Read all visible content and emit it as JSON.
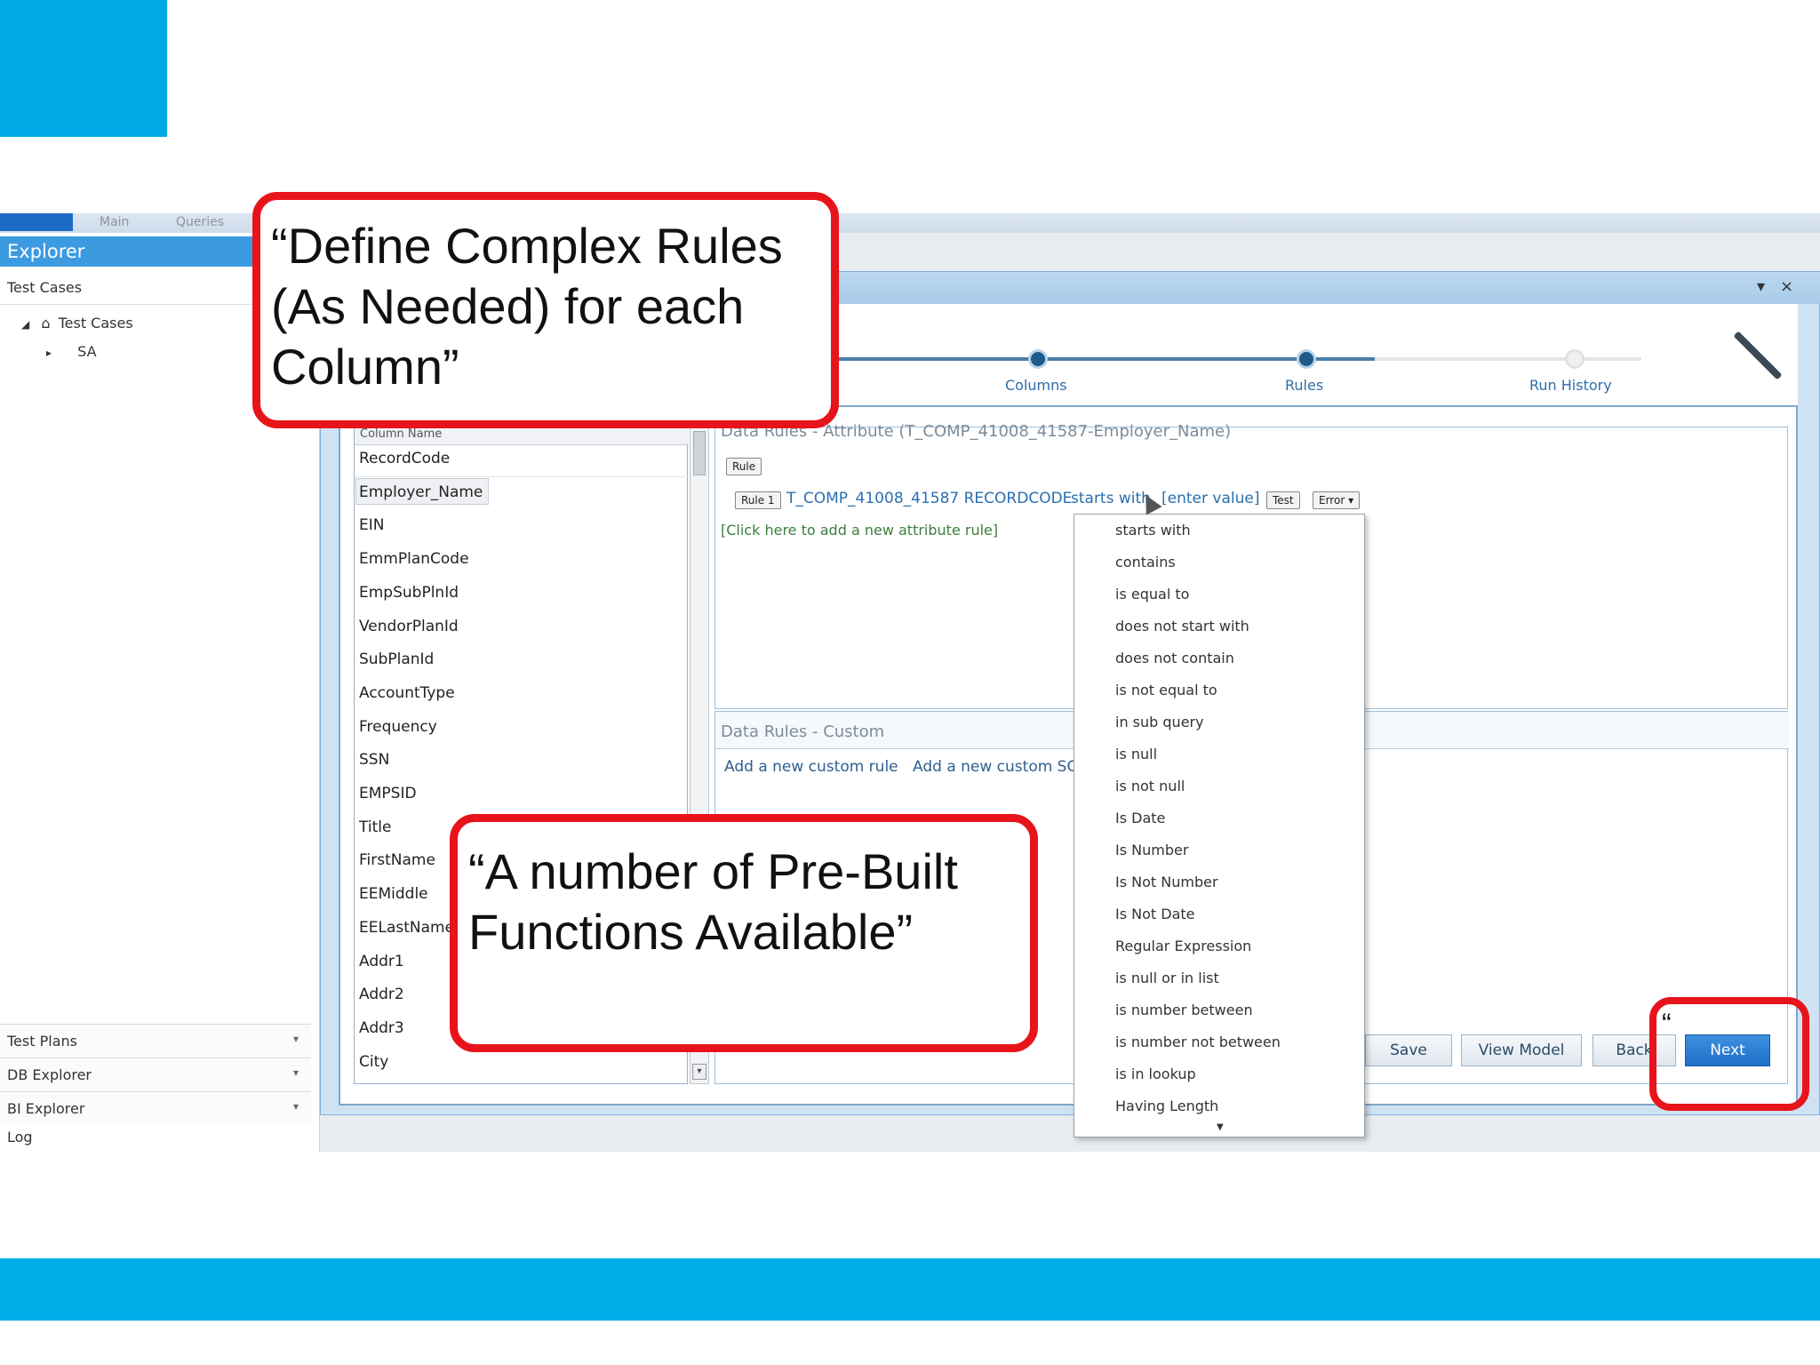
{
  "ribbon": {
    "tabs": [
      "Main",
      "Queries"
    ]
  },
  "explorer": {
    "title": "Explorer",
    "subtitle": "Test Cases",
    "tree": [
      {
        "label": "Test Cases",
        "expanded": true
      },
      {
        "label": "SA",
        "expanded": false
      }
    ],
    "bottom_nav": [
      "Test Plans",
      "DB Explorer",
      "BI Explorer"
    ],
    "log_label": "Log"
  },
  "window": {
    "controls": [
      "▾",
      "×"
    ]
  },
  "wizard": {
    "steps": [
      "Columns",
      "Rules",
      "Run History"
    ]
  },
  "columns": {
    "header": "Column Name",
    "items": [
      "RecordCode",
      "Employer_Name",
      "EIN",
      "EmmPlanCode",
      "EmpSubPlnId",
      "VendorPlanId",
      "SubPlanId",
      "AccountType",
      "Frequency",
      "SSN",
      "EMPSID",
      "Title",
      "FirstName",
      "EEMiddle",
      "EELastName",
      "Addr1",
      "Addr2",
      "Addr3",
      "City"
    ],
    "selected": "Employer_Name"
  },
  "rules_panel": {
    "title": "Data Rules - Attribute (T_COMP_41008_41587-Employer_Name)",
    "rule_button": "Rule",
    "rule_tag": "Rule 1",
    "rule_field": "T_COMP_41008_41587 RECORDCODE",
    "rule_operator": "starts with",
    "rule_value": "[enter value]",
    "test_button": "Test",
    "severity": "Error",
    "add_rule_link": "[Click here to add a new attribute rule]"
  },
  "custom_panel": {
    "title": "Data Rules - Custom",
    "links": [
      "Add a new custom rule",
      "Add a new custom SQ"
    ]
  },
  "operators_menu": [
    "starts with",
    "contains",
    "is equal to",
    "does not start with",
    "does not contain",
    "is not equal to",
    "in sub query",
    "is null",
    "is not null",
    "Is Date",
    "Is Number",
    "Is Not Number",
    "Is Not Date",
    "Regular Expression",
    "is null or in list",
    "is number between",
    "is number not between",
    "is in lookup",
    "Having Length"
  ],
  "actions": {
    "save": "Save",
    "view_model": "View Model",
    "back": "Back",
    "next": "Next"
  },
  "callouts": {
    "top": "“Define Complex Rules (As Needed) for each Column”",
    "bottom": "“A number of Pre-Built Functions Available”",
    "next_quote": "“"
  },
  "colors": {
    "accent_blue": "#00a8e6",
    "callout_red": "#e8141b",
    "next_blue": "#1e6fc8"
  }
}
